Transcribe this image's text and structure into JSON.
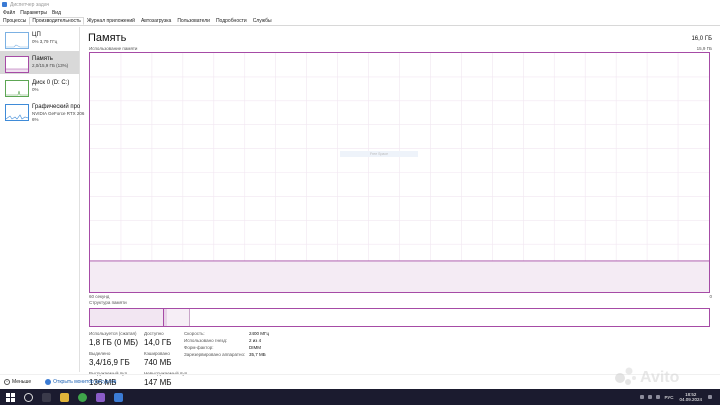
{
  "window": {
    "title": "Диспетчер задач"
  },
  "menu": {
    "items": [
      "Файл",
      "Параметры",
      "Вид"
    ]
  },
  "tabs": [
    "Процессы",
    "Производительность",
    "Журнал приложений",
    "Автозагрузка",
    "Пользователи",
    "Подробности",
    "Службы"
  ],
  "active_tab_index": 1,
  "sidebar": {
    "items": [
      {
        "title": "ЦП",
        "sub1": "0% 3,79 ГГц",
        "sub2": "",
        "icon": "cpu-graph-icon",
        "color": "#7cb1e3"
      },
      {
        "title": "Память",
        "sub1": "2,0/15,9 ГБ (13%)",
        "sub2": "",
        "icon": "memory-graph-icon",
        "color": "#a64ba6"
      },
      {
        "title": "Диск 0 (D: C:)",
        "sub1": "0%",
        "sub2": "",
        "icon": "disk-graph-icon",
        "color": "#5da654"
      },
      {
        "title": "Графический про",
        "sub1": "NVIDIA GeForce RTX 206",
        "sub2": "6%",
        "icon": "gpu-graph-icon",
        "color": "#3f8bd8"
      }
    ]
  },
  "main": {
    "heading": "Память",
    "total": "16,0 ГБ",
    "graph_label": "Использование памяти",
    "graph_max": "15,9 ГБ",
    "graph_tooltip": "Free Space",
    "axis_left": "60 секунд",
    "axis_right": "0",
    "structure_label": "Структура памяти",
    "usage_level": 0.13,
    "accent_color": "#a64ba6"
  },
  "stats": {
    "in_use_label": "Используется (сжатая)",
    "in_use_value": "1,8 ГБ (0 МБ)",
    "available_label": "Доступно",
    "available_value": "14,0 ГБ",
    "committed_label": "Выделено",
    "committed_value": "3,4/16,9 ГБ",
    "cached_label": "Кэшировано",
    "cached_value": "740 МБ",
    "paged_label": "Выгружаемый пул",
    "paged_value": "136 МБ",
    "nonpaged_label": "Невыгружаемый пул",
    "nonpaged_value": "147 МБ"
  },
  "details": [
    {
      "key": "Скорость:",
      "value": "2400 МГц"
    },
    {
      "key": "Использовано гнезд:",
      "value": "2 из 4"
    },
    {
      "key": "Форм-фактор:",
      "value": "DIMM"
    },
    {
      "key": "Зарезервировано аппаратно:",
      "value": "35,7 МБ"
    }
  ],
  "footer": {
    "less_label": "Меньше",
    "monitor_label": "Открыть монитор ресурсов"
  },
  "taskbar": {
    "lang": "РУС",
    "time": "18:52",
    "date": "04.09.2024"
  },
  "watermark": {
    "text": "Avito"
  }
}
